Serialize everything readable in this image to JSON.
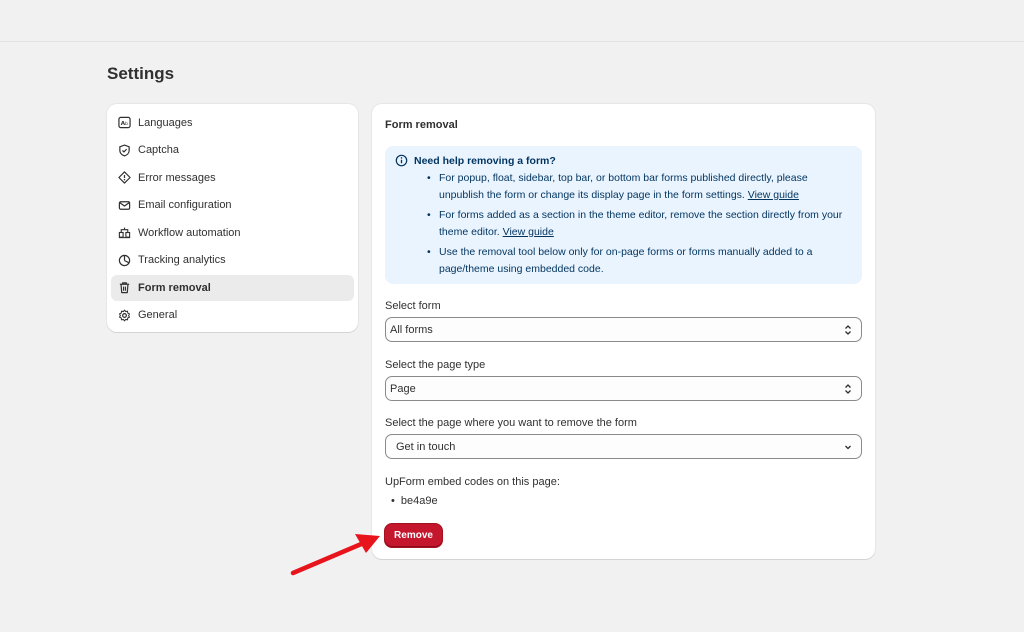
{
  "page": {
    "title": "Settings"
  },
  "sidebar": {
    "items": [
      {
        "label": "Languages",
        "icon": "language-icon"
      },
      {
        "label": "Captcha",
        "icon": "shield-check-icon"
      },
      {
        "label": "Error messages",
        "icon": "alert-diamond-icon"
      },
      {
        "label": "Email configuration",
        "icon": "email-icon"
      },
      {
        "label": "Workflow automation",
        "icon": "workflow-icon"
      },
      {
        "label": "Tracking analytics",
        "icon": "analytics-icon"
      },
      {
        "label": "Form removal",
        "icon": "trash-icon",
        "active": true
      },
      {
        "label": "General",
        "icon": "gear-icon"
      }
    ]
  },
  "card": {
    "title": "Form removal",
    "banner": {
      "heading": "Need help removing a form?",
      "items": [
        {
          "text": "For popup, float, sidebar, top bar, or bottom bar forms published directly, please unpublish the form or change its display page in the form settings.",
          "link": "View guide"
        },
        {
          "text": "For forms added as a section in the theme editor, remove the section directly from your theme editor.",
          "link": "View guide"
        },
        {
          "text": "Use the removal tool below only for on-page forms or forms manually added to a page/theme using embedded code.",
          "link": ""
        }
      ]
    },
    "select_form": {
      "label": "Select form",
      "value": "All forms"
    },
    "select_page_type": {
      "label": "Select the page type",
      "value": "Page"
    },
    "select_page": {
      "label": "Select the page where you want to remove the form",
      "value": "Get in touch"
    },
    "embed": {
      "label": "UpForm embed codes on this page:",
      "codes": [
        "be4a9e"
      ]
    },
    "remove_label": "Remove"
  },
  "colors": {
    "accent_red": "#c4162d",
    "banner_bg": "#eaf4ff",
    "arrow": "#e8141c"
  }
}
